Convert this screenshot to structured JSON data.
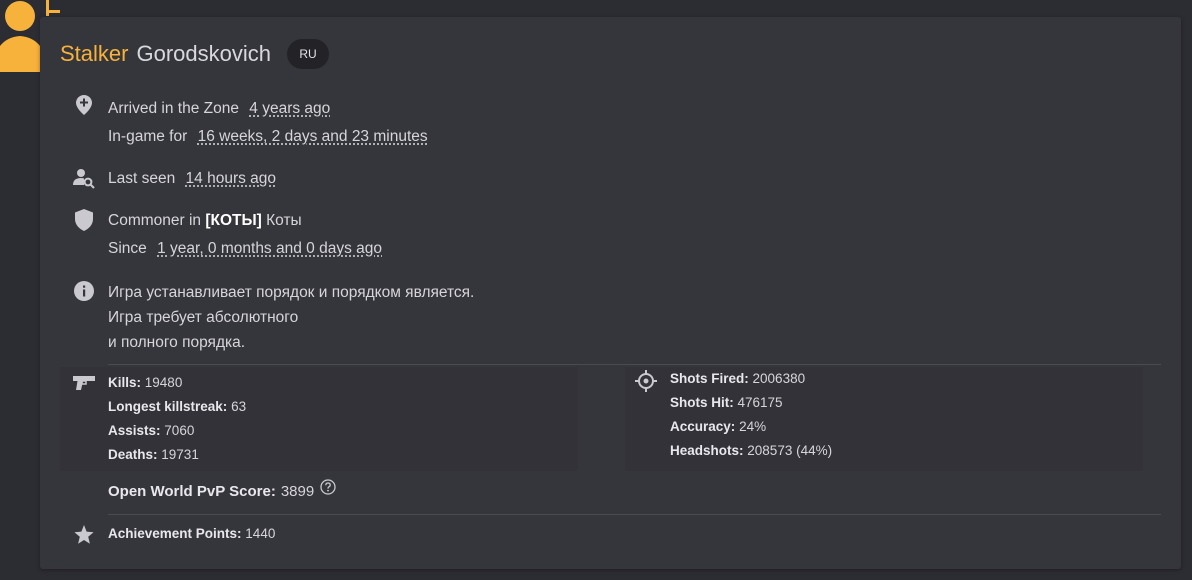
{
  "profile": {
    "first_name": "Stalker",
    "last_name": "Gorodskovich",
    "region": "RU",
    "avatar_icon": "player-avatar-icon",
    "accent_color": "#f7b23c"
  },
  "arrived": {
    "icon": "location-plus-icon",
    "label": "Arrived in the Zone",
    "value": "4 years ago",
    "ingame_label": "In-game for",
    "ingame_value": "16 weeks, 2 days and 23 minutes"
  },
  "last_seen": {
    "icon": "user-search-icon",
    "label": "Last seen",
    "value": "14 hours ago"
  },
  "clan": {
    "icon": "shield-icon",
    "rank": "Commoner in",
    "tag": "[КОТЫ]",
    "name": "Коты",
    "since_label": "Since",
    "since_value": "1 year, 0 months and 0 days ago"
  },
  "about": {
    "icon": "info-icon",
    "lines": [
      "Игра устанавливает порядок и порядком является.",
      "Игра требует абсолютного",
      "и полного порядка."
    ]
  },
  "combat": {
    "icon": "gun-icon",
    "kills_label": "Kills:",
    "kills": "19480",
    "streak_label": "Longest killstreak:",
    "streak": "63",
    "assists_label": "Assists:",
    "assists": "7060",
    "deaths_label": "Deaths:",
    "deaths": "19731"
  },
  "shooting": {
    "icon": "crosshair-icon",
    "fired_label": "Shots Fired:",
    "fired": "2006380",
    "hit_label": "Shots Hit:",
    "hit": "476175",
    "accuracy_label": "Accuracy:",
    "accuracy": "24%",
    "headshots_label": "Headshots:",
    "headshots": "208573 (44%)"
  },
  "pvp": {
    "label": "Open World PvP Score:",
    "value": "3899",
    "help_icon": "help-circle-icon"
  },
  "achievements": {
    "icon": "star-icon",
    "label": "Achievement Points:",
    "value": "1440"
  }
}
